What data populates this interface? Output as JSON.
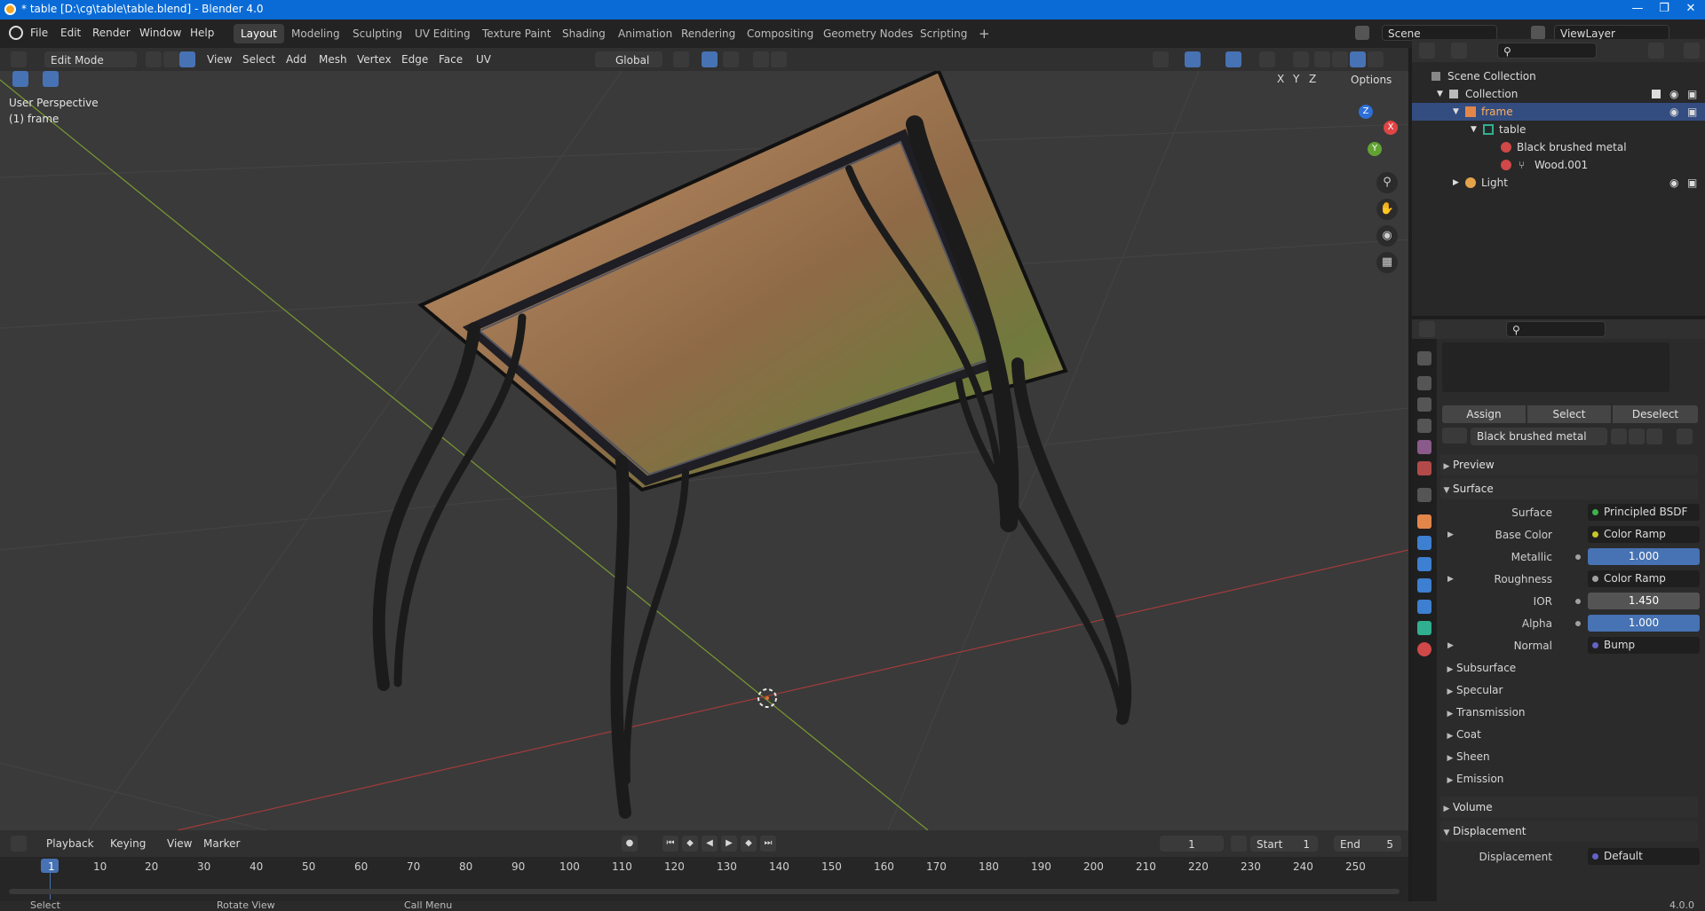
{
  "window": {
    "title": "* table [D:\\cg\\table\\table.blend] - Blender 4.0",
    "minimize": "—",
    "maximize": "❐",
    "close": "✕"
  },
  "topmenu": {
    "items": [
      "File",
      "Edit",
      "Render",
      "Window",
      "Help"
    ]
  },
  "workspaces": {
    "tabs": [
      "Layout",
      "Modeling",
      "Sculpting",
      "UV Editing",
      "Texture Paint",
      "Shading",
      "Animation",
      "Rendering",
      "Compositing",
      "Geometry Nodes",
      "Scripting"
    ],
    "active": "Layout",
    "add": "+"
  },
  "scene": {
    "name": "Scene",
    "view_layer": "ViewLayer"
  },
  "viewport_header": {
    "mode": "Edit Mode",
    "menus": [
      "View",
      "Select",
      "Add",
      "Mesh",
      "Vertex",
      "Edge",
      "Face",
      "UV"
    ],
    "orientation": "Global",
    "options": "Options",
    "axes": [
      "X",
      "Y",
      "Z"
    ]
  },
  "viewport": {
    "perspective": "User Perspective",
    "object": "(1) frame",
    "gizmo": {
      "x": "X",
      "y": "Y",
      "z": "Z"
    }
  },
  "timeline_header": {
    "menus": [
      "Playback",
      "Keying",
      "View",
      "Marker"
    ],
    "current_frame": "1",
    "start_label": "Start",
    "start": "1",
    "end_label": "End",
    "end": "5"
  },
  "timeline": {
    "ticks": [
      "1",
      "10",
      "20",
      "30",
      "40",
      "50",
      "60",
      "70",
      "80",
      "90",
      "100",
      "110",
      "120",
      "130",
      "140",
      "150",
      "160",
      "170",
      "180",
      "190",
      "200",
      "210",
      "220",
      "230",
      "240",
      "250"
    ]
  },
  "statusbar": {
    "items": [
      "Select",
      "Rotate View",
      "Call Menu"
    ],
    "version": "4.0.0"
  },
  "outliner": {
    "rows": [
      {
        "label": "Scene Collection",
        "indent": 0,
        "icon": "scene-collection-icon"
      },
      {
        "label": "Collection",
        "indent": 1,
        "icon": "collection-icon"
      },
      {
        "label": "frame",
        "indent": 2,
        "icon": "mesh-object-icon",
        "selected": true
      },
      {
        "label": "table",
        "indent": 3,
        "icon": "mesh-data-icon"
      },
      {
        "label": "Black brushed metal",
        "indent": 4,
        "icon": "material-icon"
      },
      {
        "label": "Wood.001",
        "indent": 4,
        "icon": "material-icon"
      },
      {
        "label": "Light",
        "indent": 2,
        "icon": "light-icon"
      }
    ]
  },
  "material": {
    "buttons": {
      "assign": "Assign",
      "select": "Select",
      "deselect": "Deselect"
    },
    "name": "Black brushed metal",
    "sections": {
      "preview": "Preview",
      "surface": "Surface",
      "volume": "Volume",
      "displacement": "Displacement"
    },
    "surface": {
      "label": "Surface",
      "value": "Principled BSDF"
    },
    "fields": [
      {
        "label": "Base Color",
        "value": "Color Ramp",
        "kind": "link",
        "expand": true,
        "dot": "#c7c729"
      },
      {
        "label": "Metallic",
        "value": "1.000",
        "kind": "num",
        "dot": "#a1a1a1"
      },
      {
        "label": "Roughness",
        "value": "Color Ramp",
        "kind": "link",
        "expand": true,
        "dot": "#a1a1a1"
      },
      {
        "label": "IOR",
        "value": "1.450",
        "kind": "num2",
        "dot": "#a1a1a1"
      },
      {
        "label": "Alpha",
        "value": "1.000",
        "kind": "num",
        "dot": "#a1a1a1"
      },
      {
        "label": "Normal",
        "value": "Bump",
        "kind": "link",
        "expand": true,
        "dot": "#6363c7"
      }
    ],
    "subpanels": [
      "Subsurface",
      "Specular",
      "Transmission",
      "Coat",
      "Sheen",
      "Emission"
    ],
    "displacement": {
      "label": "Displacement",
      "value": "Default"
    }
  },
  "colors": {
    "accent": "#4772b3",
    "header": "#303030",
    "viewport": "#3a3a3a",
    "titlebar": "#0a6bd6"
  }
}
